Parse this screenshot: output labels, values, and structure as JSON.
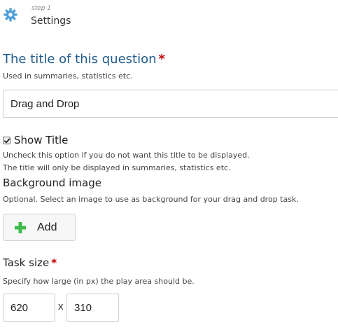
{
  "header": {
    "step_label": "step 1",
    "title": "Settings",
    "icon": "gear-icon",
    "icon_color": "#4a9fd8"
  },
  "title_field": {
    "label": "The title of this question",
    "required_mark": "*",
    "description": "Used in summaries, statistics etc.",
    "value": "Drag and Drop"
  },
  "show_title": {
    "label": "Show Title",
    "checked": true,
    "description_line1": "Uncheck this option if you do not want this title to be displayed.",
    "description_line2": "The title will only be displayed in summaries, statistics etc."
  },
  "background_image": {
    "label": "Background image",
    "description": "Optional. Select an image to use as background for your drag and drop task.",
    "add_button_label": "Add",
    "add_icon": "plus-icon",
    "add_icon_color": "#3dbb4b"
  },
  "task_size": {
    "label": "Task size",
    "required_mark": "*",
    "description": "Specify how large (in px) the play area should be.",
    "width_value": "620",
    "separator": "x",
    "height_value": "310"
  },
  "colors": {
    "title_blue": "#1f5a8c",
    "required_red": "#c40000"
  }
}
